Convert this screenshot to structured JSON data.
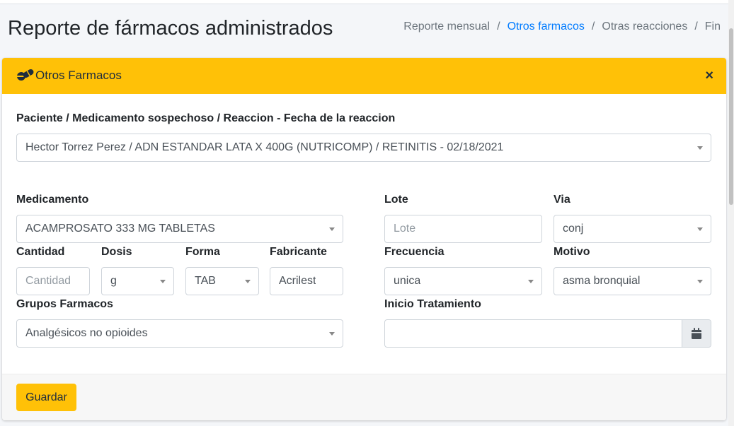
{
  "page": {
    "title": "Reporte de fármacos administrados"
  },
  "breadcrumb": [
    {
      "label": "Reporte mensual",
      "active": false
    },
    {
      "label": "Otros farmacos",
      "active": true
    },
    {
      "label": "Otras reacciones",
      "active": false
    },
    {
      "label": "Fin",
      "active": false
    }
  ],
  "breadcrumb_separator": "/",
  "card": {
    "header_title": "Otros Farmacos",
    "header_icon": "pills-icon",
    "close_label": "×"
  },
  "form": {
    "patient_label": "Paciente / Medicamento sospechoso / Reaccion - Fecha de la reaccion",
    "patient_value": "Hector Torrez Perez / ADN ESTANDAR LATA X 400G (NUTRICOMP) / RETINITIS - 02/18/2021",
    "medicamento_label": "Medicamento",
    "medicamento_value": "ACAMPROSATO 333 MG TABLETAS",
    "lote_label": "Lote",
    "lote_placeholder": "Lote",
    "via_label": "Via",
    "via_value": "conj",
    "cantidad_label": "Cantidad",
    "cantidad_placeholder": "Cantidad",
    "dosis_label": "Dosis",
    "dosis_value": "g",
    "forma_label": "Forma",
    "forma_value": "TAB",
    "fabricante_label": "Fabricante",
    "fabricante_value": "Acrilest",
    "frecuencia_label": "Frecuencia",
    "frecuencia_value": "unica",
    "motivo_label": "Motivo",
    "motivo_value": "asma bronquial",
    "grupos_label": "Grupos Farmacos",
    "grupos_value": "Analgésicos no opioides",
    "inicio_label": "Inicio Tratamiento",
    "inicio_value": "",
    "calendar_icon": "calendar-icon"
  },
  "footer": {
    "save_label": "Guardar"
  },
  "colors": {
    "accent": "#ffc107",
    "link": "#007bff"
  }
}
